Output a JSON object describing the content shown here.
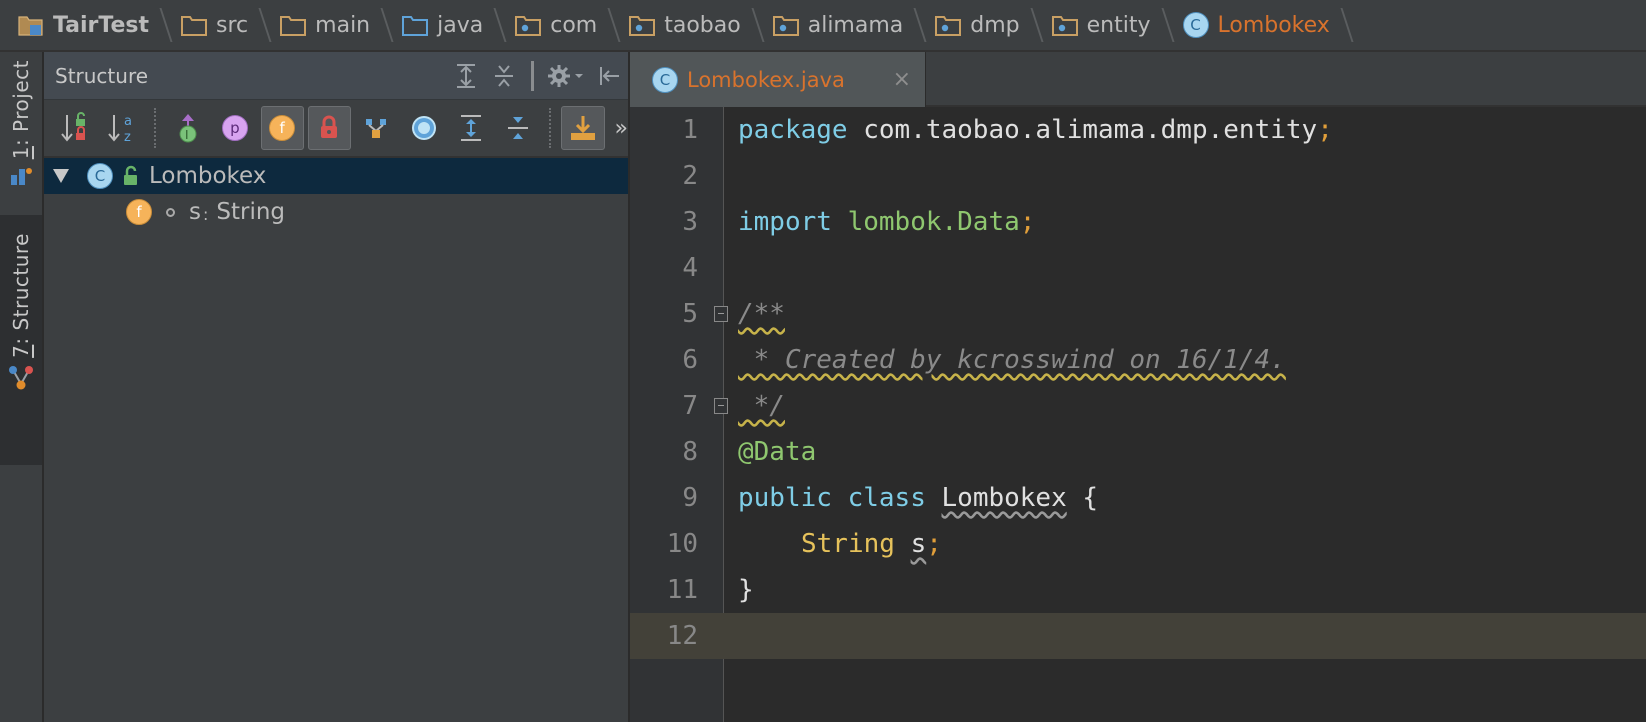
{
  "breadcrumb": [
    {
      "label": "TairTest",
      "icon": "project-folder-icon"
    },
    {
      "label": "src",
      "icon": "folder-icon"
    },
    {
      "label": "main",
      "icon": "folder-icon"
    },
    {
      "label": "java",
      "icon": "source-folder-icon"
    },
    {
      "label": "com",
      "icon": "package-icon"
    },
    {
      "label": "taobao",
      "icon": "package-icon"
    },
    {
      "label": "alimama",
      "icon": "package-icon"
    },
    {
      "label": "dmp",
      "icon": "package-icon"
    },
    {
      "label": "entity",
      "icon": "package-icon"
    },
    {
      "label": "Lombokex",
      "icon": "class-icon"
    }
  ],
  "toolwindows": {
    "project": {
      "number": "1",
      "label": "Project"
    },
    "structure": {
      "number": "7",
      "label": "Structure"
    }
  },
  "structure_panel": {
    "title": "Structure",
    "header_buttons": [
      "expand-all-icon",
      "collapse-all-icon",
      "gear-icon",
      "hide-icon"
    ],
    "toolbar_buttons": [
      "sort-by-visibility-icon",
      "sort-alphabetically-icon",
      "show-inherited-icon",
      "show-properties-icon",
      "show-fields-icon",
      "show-non-public-icon",
      "group-methods-icon",
      "show-lambdas-icon",
      "expand-all-icon",
      "collapse-all-icon",
      "autoscroll-from-source-icon"
    ],
    "more_label": "»",
    "tree": {
      "root": {
        "name": "Lombokex",
        "badge": "C"
      },
      "children": [
        {
          "badge": "f",
          "name": "s",
          "separator": ":",
          "type": "String"
        }
      ]
    }
  },
  "editor": {
    "tab": {
      "badge": "C",
      "label": "Lombokex.java",
      "close": "×"
    },
    "lines": [
      {
        "n": "1"
      },
      {
        "n": "2"
      },
      {
        "n": "3"
      },
      {
        "n": "4"
      },
      {
        "n": "5"
      },
      {
        "n": "6"
      },
      {
        "n": "7"
      },
      {
        "n": "8"
      },
      {
        "n": "9"
      },
      {
        "n": "10"
      },
      {
        "n": "11"
      },
      {
        "n": "12"
      }
    ],
    "tokens": {
      "l1_kw": "package",
      "l1_rest": " com.taobao.alimama.dmp.entity",
      "semicolon": ";",
      "l3_kw": "import",
      "l3_rest": "lombok.Data",
      "l5": "/**",
      "l6": " * Created by kcrosswind on 16/1/4.",
      "l7": " */",
      "l8": "@Data",
      "l9_kw1": "public",
      "l9_kw2": "class",
      "l9_name": "Lombokex",
      "l9_brace": " {",
      "l10_type": "String",
      "l10_var": "s",
      "l11": "}"
    },
    "current_line": "12"
  },
  "colors": {
    "accent_orange": "#d9732d",
    "keyword": "#7fcde6",
    "annotation_green": "#8fc76f",
    "selection": "#0d293e"
  }
}
